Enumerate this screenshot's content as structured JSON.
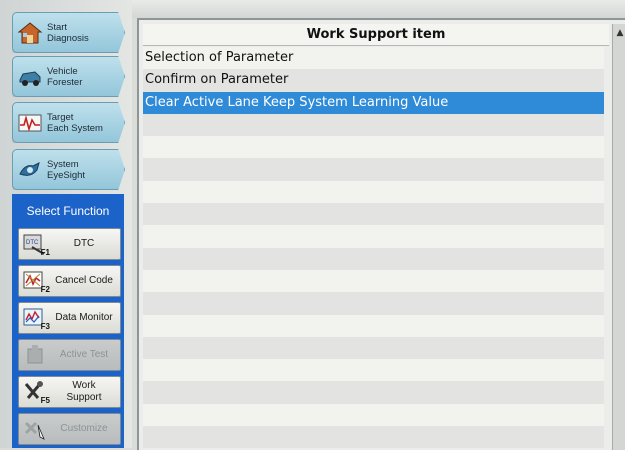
{
  "sidebar": {
    "nav": [
      {
        "label": "Start\nDiagnosis",
        "icon": "house-icon"
      },
      {
        "label": "Vehicle\nForester",
        "icon": "car-icon"
      },
      {
        "label": "Target\nEach System",
        "icon": "wave-icon"
      },
      {
        "label": "System\nEyeSight",
        "icon": "eyesight-icon"
      }
    ],
    "function_title": "Select Function",
    "functions": [
      {
        "label": "DTC",
        "key": "F1",
        "icon": "dtc-icon",
        "enabled": true
      },
      {
        "label": "Cancel Code",
        "key": "F2",
        "icon": "cancel-code-icon",
        "enabled": true
      },
      {
        "label": "Data Monitor",
        "key": "F3",
        "icon": "data-monitor-icon",
        "enabled": true
      },
      {
        "label": "Active Test",
        "key": "",
        "icon": "active-test-icon",
        "enabled": false
      },
      {
        "label": "Work\nSupport",
        "key": "F5",
        "icon": "work-support-icon",
        "enabled": true
      },
      {
        "label": "Customize",
        "key": "",
        "icon": "customize-icon",
        "enabled": false
      }
    ]
  },
  "main": {
    "header": "Work Support item",
    "items": [
      "Selection of Parameter",
      "Confirm on Parameter",
      "Clear Active Lane Keep System Learning Value"
    ],
    "selected_index": 2,
    "colors": {
      "selected": "#2f8bd8",
      "function_panel": "#1c63c9"
    }
  }
}
